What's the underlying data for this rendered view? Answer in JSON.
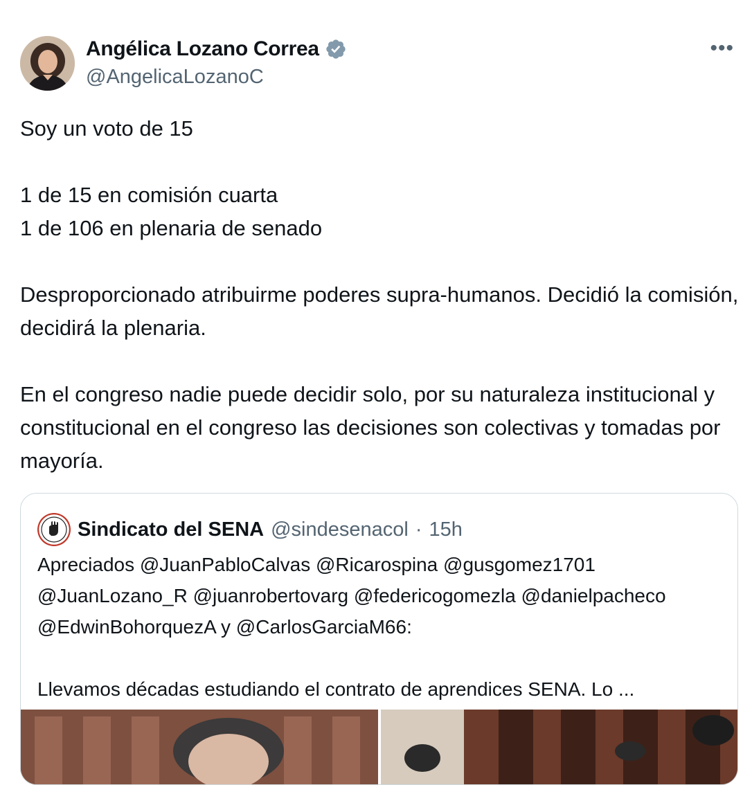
{
  "author": {
    "name": "Angélica Lozano Correa",
    "handle": "@AngelicaLozanoC",
    "verified": true
  },
  "more_label": "•••",
  "tweet": {
    "lines": [
      "Soy un voto de 15",
      "1 de 15 en comisión cuarta",
      "1 de 106 en plenaria de senado",
      "Desproporcionado atribuirme poderes supra-humanos.  Decidió la comisión, decidirá la plenaria.",
      "En el congreso nadie puede decidir solo, por su naturaleza institucional y constitucional en el congreso las decisiones son colectivas y tomadas por mayoría."
    ]
  },
  "quote": {
    "name": "Sindicato del SENA",
    "handle": "@sindesenacol",
    "separator": "·",
    "time": "15h",
    "text_1": "Apreciados @JuanPabloCalvas @Ricarospina @gusgomez1701 @JuanLozano_R @juanrobertovarg @federicogomezla @danielpacheco @EdwinBohorquezA y @CarlosGarciaM66:",
    "text_2": "Llevamos décadas estudiando el contrato de aprendices SENA. Lo ..."
  },
  "colors": {
    "text": "#0f1419",
    "secondary": "#536471",
    "border": "#cfd9de",
    "verified_badge": "#829aab"
  }
}
